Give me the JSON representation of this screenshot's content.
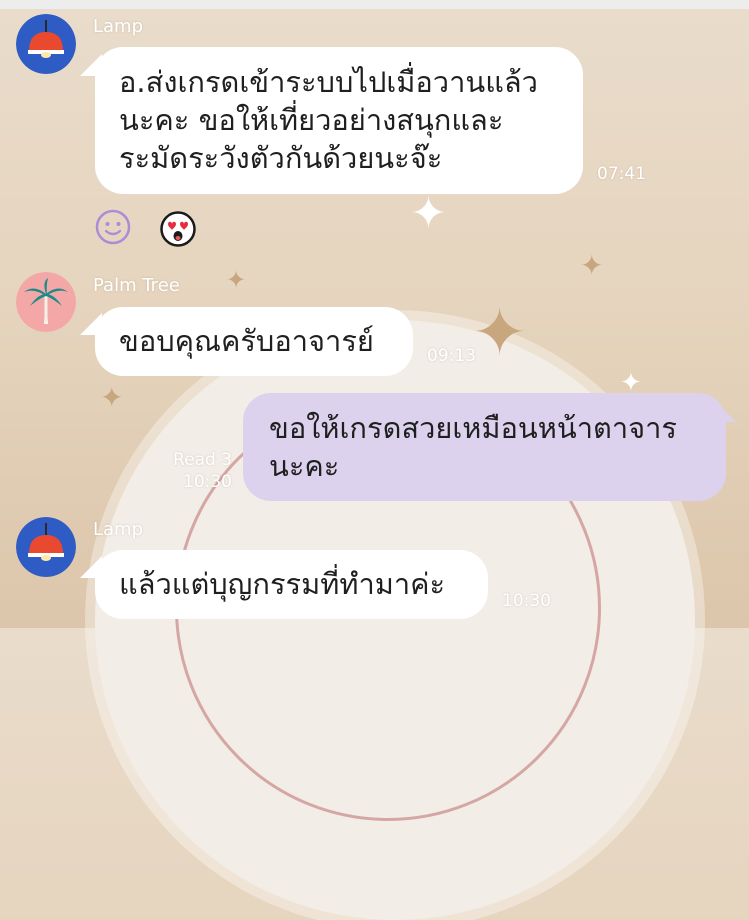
{
  "messages": [
    {
      "sender": "Lamp",
      "direction": "incoming",
      "lines": [
        "อ.ส่งเกรดเข้าระบบไปเมื่อวานแล้ว",
        "นะคะ ขอให้เที่ยวอย่างสนุกและ",
        "ระมัดระวังตัวกันด้วยนะจ๊ะ"
      ],
      "time": "07:41",
      "reactions": [
        "smiley-outline-icon",
        "heart-eyes-sticker-icon"
      ]
    },
    {
      "sender": "Palm Tree",
      "direction": "incoming",
      "lines": [
        "ขอบคุณครับอาจารย์"
      ],
      "time": "09:13"
    },
    {
      "sender": "",
      "direction": "outgoing",
      "lines": [
        "ขอให้เกรดสวยเหมือนหน้าตาจาร",
        "นะคะ"
      ],
      "read": "Read 3",
      "time": "10:30"
    },
    {
      "sender": "Lamp",
      "direction": "incoming",
      "lines": [
        "แล้วแต่บุญกรรมที่ทำมาค่ะ"
      ],
      "time": "10:30"
    }
  ],
  "colors": {
    "incoming_bubble": "#ffffff",
    "outgoing_bubble": "#dcd2ee",
    "lamp_avatar": "#2f5cc4",
    "palm_avatar": "#f3a7a7"
  }
}
